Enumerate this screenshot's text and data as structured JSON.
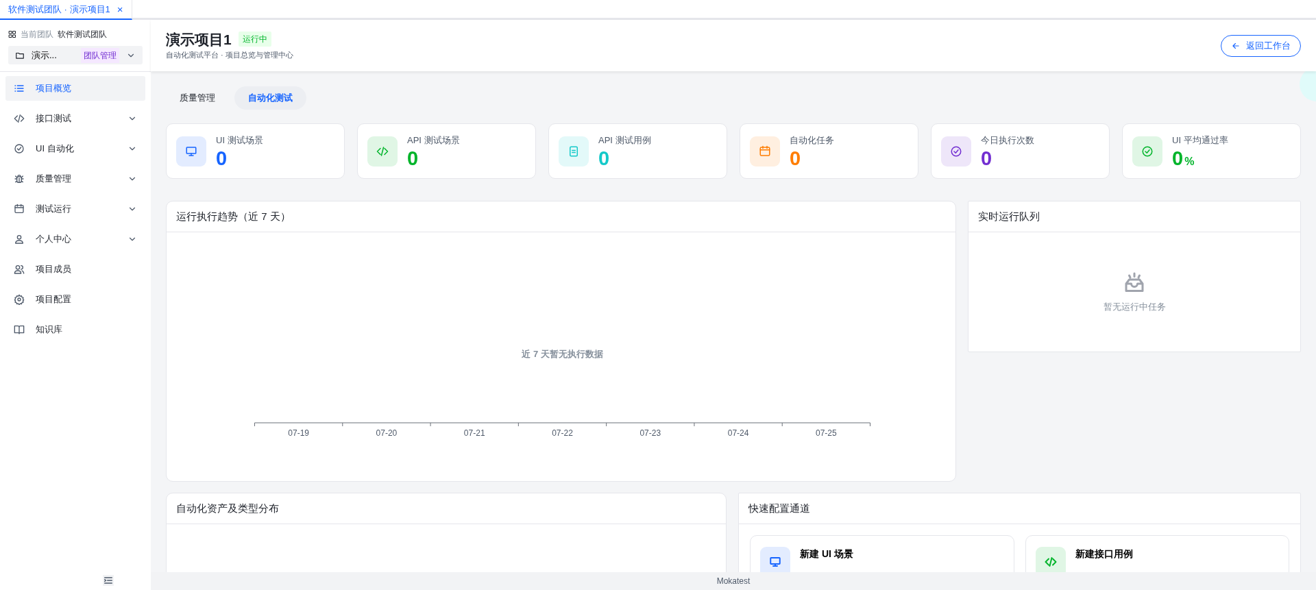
{
  "window_tab": {
    "label": "软件测试团队 · 演示项目1",
    "close": "×",
    "selected": true
  },
  "sidebar": {
    "team_label": "当前团队",
    "team_name": "软件测试团队",
    "project": "演示...",
    "role_badge": "团队管理",
    "items": [
      {
        "label": "项目概览",
        "selected": true,
        "has_submenu": false
      },
      {
        "label": "接口测试",
        "selected": false,
        "has_submenu": true
      },
      {
        "label": "UI 自动化",
        "selected": false,
        "has_submenu": true
      },
      {
        "label": "质量管理",
        "selected": false,
        "has_submenu": true
      },
      {
        "label": "测试运行",
        "selected": false,
        "has_submenu": true
      },
      {
        "label": "个人中心",
        "selected": false,
        "has_submenu": true
      },
      {
        "label": "项目成员",
        "selected": false,
        "has_submenu": false
      },
      {
        "label": "项目配置",
        "selected": false,
        "has_submenu": false
      },
      {
        "label": "知识库",
        "selected": false,
        "has_submenu": false
      }
    ]
  },
  "header": {
    "title": "演示项目1",
    "status": "运行中",
    "subtitle": "自动化测试平台 · 项目总览与管理中心",
    "back_button": "返回工作台"
  },
  "tabs": [
    {
      "label": "质量管理",
      "selected": false
    },
    {
      "label": "自动化测试",
      "selected": true
    }
  ],
  "stats": [
    {
      "label": "UI 测试场景",
      "value": "0",
      "color": "#1664ff"
    },
    {
      "label": "API 测试场景",
      "value": "0",
      "color": "#00b42a"
    },
    {
      "label": "API 测试用例",
      "value": "0",
      "color": "#14c9c9"
    },
    {
      "label": "自动化任务",
      "value": "0",
      "color": "#ff7d00"
    },
    {
      "label": "今日执行次数",
      "value": "0",
      "color": "#722ed1"
    },
    {
      "label": "UI 平均通过率",
      "value": "0",
      "unit": "%",
      "color": "#00b42a"
    }
  ],
  "trend": {
    "title": "运行执行趋势（近 7 天）",
    "empty_text": "近 7 天暂无执行数据",
    "axis_labels": [
      "07-19",
      "07-20",
      "07-21",
      "07-22",
      "07-23",
      "07-24",
      "07-25"
    ]
  },
  "queue": {
    "title": "实时运行队列",
    "empty_text": "暂无运行中任务"
  },
  "assets": {
    "title": "自动化资产及类型分布"
  },
  "quick": {
    "title": "快速配置通道",
    "items": [
      {
        "title": "新建 UI 场景",
        "color": "#1664ff"
      },
      {
        "title": "新建接口用例",
        "color": "#00b42a"
      }
    ]
  },
  "footer": "Mokatest"
}
